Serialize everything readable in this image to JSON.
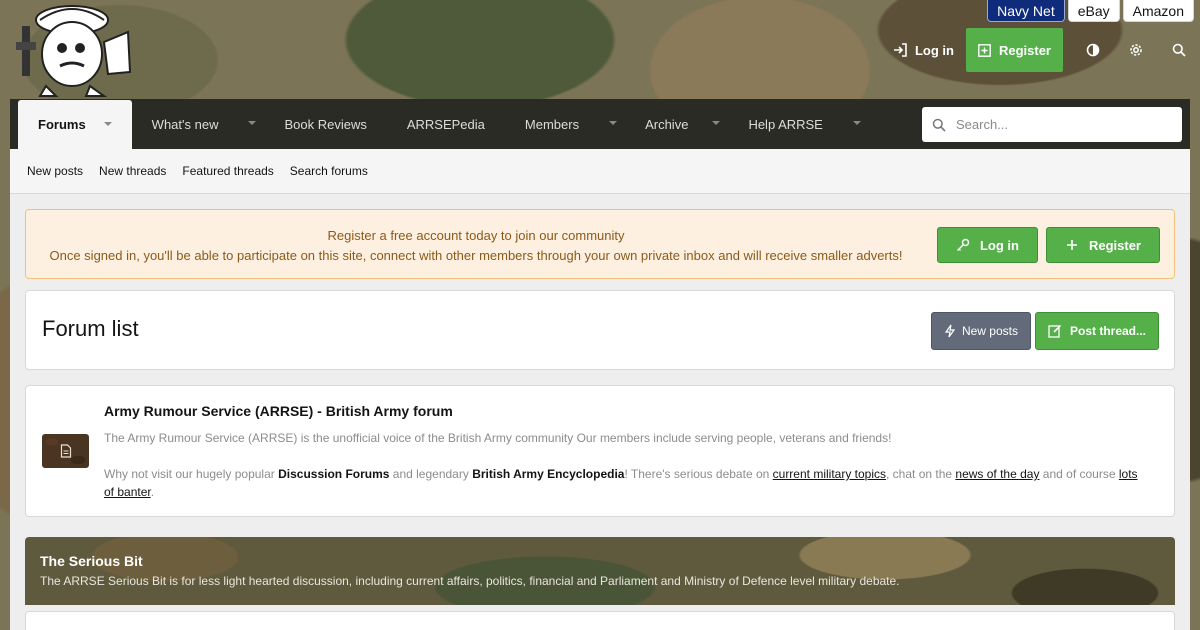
{
  "external_links": [
    "Navy Net",
    "eBay",
    "Amazon"
  ],
  "header": {
    "login_label": "Log in",
    "register_label": "Register"
  },
  "nav": {
    "tabs": [
      {
        "label": "Forums",
        "caret": true,
        "active": true
      },
      {
        "label": "What's new",
        "caret": true
      },
      {
        "label": "Book Reviews",
        "caret": false
      },
      {
        "label": "ARRSEPedia",
        "caret": false
      },
      {
        "label": "Members",
        "caret": true
      },
      {
        "label": "Archive",
        "caret": true
      },
      {
        "label": "Help ARRSE",
        "caret": true
      }
    ],
    "search_placeholder": "Search..."
  },
  "subnav": [
    "New posts",
    "New threads",
    "Featured threads",
    "Search forums"
  ],
  "notice": {
    "line1": "Register a free account today to join our community",
    "line2": "Once signed in, you'll be able to participate on this site, connect with other members through your own private inbox and will receive smaller adverts!",
    "login_label": "Log in",
    "register_label": "Register"
  },
  "page": {
    "title": "Forum list",
    "new_posts_label": "New posts",
    "post_thread_label": "Post thread..."
  },
  "arrse_node": {
    "title": "Army Rumour Service (ARRSE) - British Army forum",
    "desc1": "The Army Rumour Service (ARRSE) is the unofficial voice of the British Army community Our members include serving people, veterans and friends!",
    "desc2_pre": "Why not visit our hugely popular ",
    "desc2_b1": "Discussion Forums",
    "desc2_mid1": " and legendary ",
    "desc2_b2": "British Army Encyclopedia",
    "desc2_mid2": "! There's serious debate on ",
    "desc2_l1": "current military topics",
    "desc2_mid3": ", chat on the ",
    "desc2_l2": "news of the day",
    "desc2_mid4": " and of course ",
    "desc2_l3": "lots of banter",
    "desc2_end": "."
  },
  "category": {
    "title": "The Serious Bit",
    "desc": "The ARRSE Serious Bit is for less light hearted discussion, including current affairs, politics, financial and Parliament and Ministry of Defence level military debate."
  },
  "colors": {
    "nav_bg": "#2b2b26",
    "green": "#55b04a",
    "notice_bg": "#fdf0e0",
    "navy": "#0f2b7c"
  }
}
